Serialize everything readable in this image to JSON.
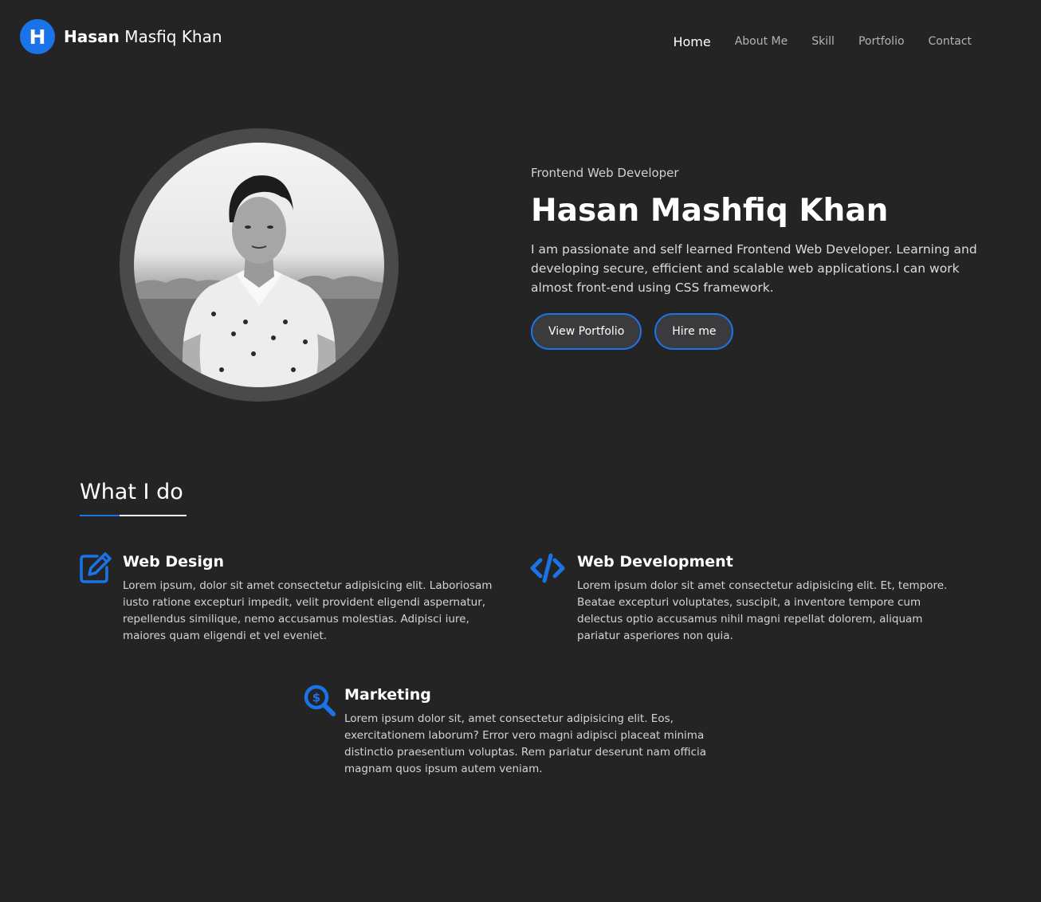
{
  "header": {
    "logo_letter": "H",
    "brand_first": "Hasan",
    "brand_rest": " Masfiq Khan",
    "nav": [
      {
        "label": "Home",
        "active": true
      },
      {
        "label": "About Me",
        "active": false
      },
      {
        "label": "Skill",
        "active": false
      },
      {
        "label": "Portfolio",
        "active": false
      },
      {
        "label": "Contact",
        "active": false
      }
    ]
  },
  "hero": {
    "role": "Frontend Web Developer",
    "name": "Hasan Mashfiq Khan",
    "description": "I am passionate and self learned Frontend Web Developer. Learning and developing secure, efficient and scalable web applications.I can work almost front-end using CSS framework.",
    "buttons": {
      "view_portfolio": "View Portfolio",
      "hire_me": "Hire me"
    }
  },
  "services": {
    "title": "What I do",
    "items": [
      {
        "title": "Web Design",
        "icon": "edit-icon",
        "description": "Lorem ipsum, dolor sit amet consectetur adipisicing elit. Laboriosam iusto ratione excepturi impedit, velit provident eligendi aspernatur, repellendus similique, nemo accusamus molestias. Adipisci iure, maiores quam eligendi et vel eveniet."
      },
      {
        "title": "Web Development",
        "icon": "code-icon",
        "description": "Lorem ipsum dolor sit amet consectetur adipisicing elit. Et, tempore. Beatae excepturi voluptates, suscipit, a inventore tempore cum delectus optio accusamus nihil magni repellat dolorem, aliquam pariatur asperiores non quia."
      },
      {
        "title": "Marketing",
        "icon": "search-dollar-icon",
        "description": "Lorem ipsum dolor sit, amet consectetur adipisicing elit. Eos, exercitationem laborum? Error vero magni adipisci placeat minima distinctio praesentium voluptas. Rem pariatur deserunt nam officia magnam quos ipsum autem veniam."
      }
    ]
  },
  "colors": {
    "background": "#242425",
    "accent": "#1a74e8",
    "ring": "#4a4a4b"
  }
}
